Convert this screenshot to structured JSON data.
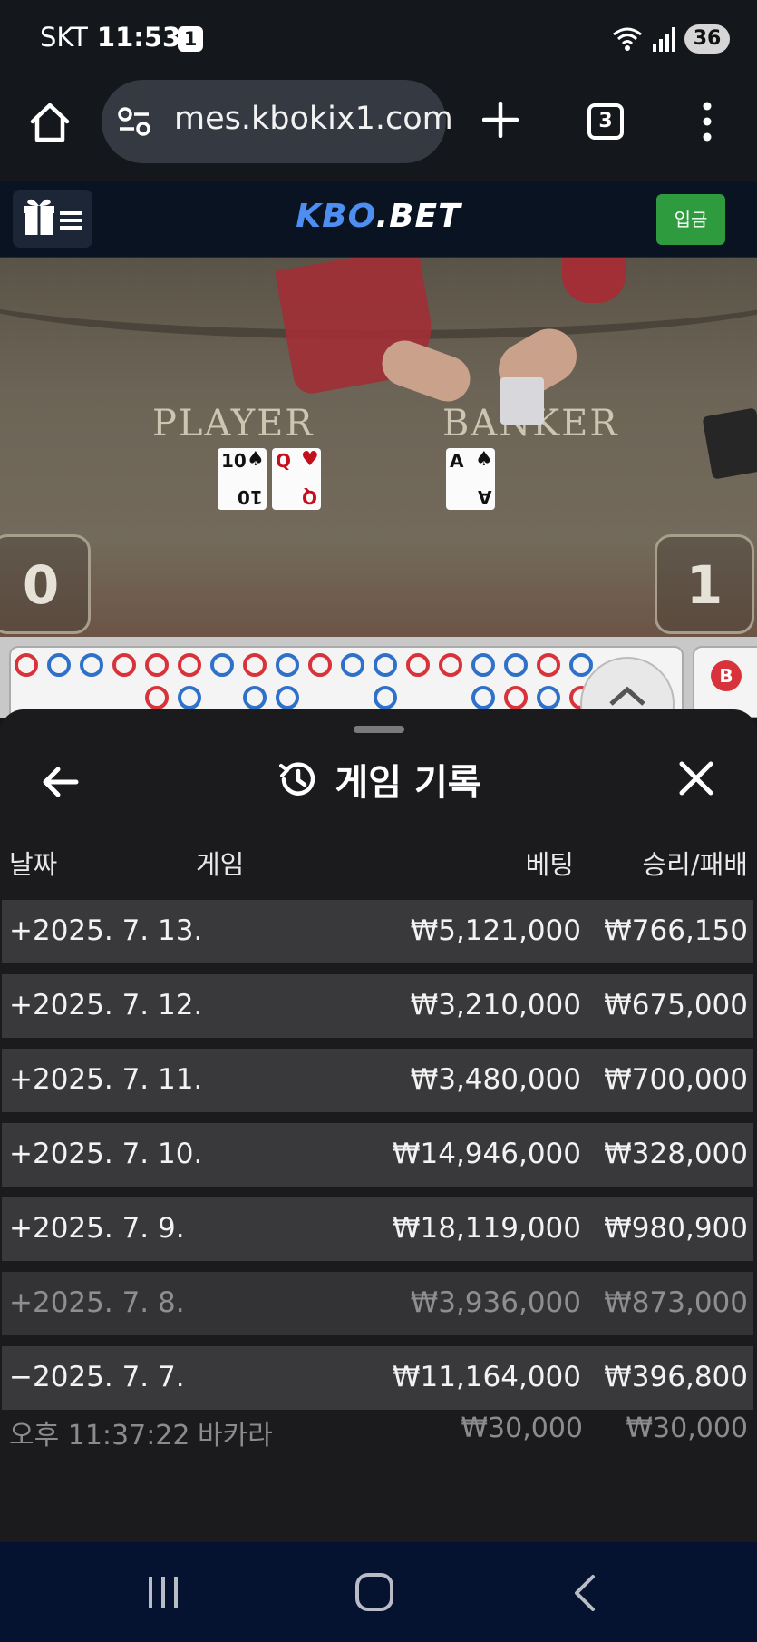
{
  "status_bar": {
    "carrier": "SKT",
    "time": "11:53",
    "notification_count": "1",
    "battery": "36"
  },
  "browser": {
    "url": "mes.kbokix1.com",
    "tab_count": "3"
  },
  "site_header": {
    "logo_prefix": "KBO",
    "logo_suffix": ".BET",
    "deposit_label": "입금"
  },
  "video": {
    "player_label": "PLAYER",
    "banker_label": "BANKER",
    "player_score": "0",
    "banker_score": "1",
    "player_cards": [
      {
        "rank": "10",
        "suit": "♠",
        "color": "#111111"
      },
      {
        "rank": "Q",
        "suit": "♥",
        "color": "#c4101d"
      }
    ],
    "banker_cards": [
      {
        "rank": "A",
        "suit": "♠",
        "color": "#111111"
      }
    ]
  },
  "roadmap": {
    "side_badge": "B"
  },
  "sheet": {
    "title": "게임 기록",
    "columns": {
      "date": "날짜",
      "game": "게임",
      "bet": "베팅",
      "result": "승리/패배"
    },
    "records": [
      {
        "date": "+2025. 7. 13.",
        "bet": "₩5,121,000",
        "result": "₩766,150"
      },
      {
        "date": "+2025. 7. 12.",
        "bet": "₩3,210,000",
        "result": "₩675,000"
      },
      {
        "date": "+2025. 7. 11.",
        "bet": "₩3,480,000",
        "result": "₩700,000"
      },
      {
        "date": "+2025. 7. 10.",
        "bet": "₩14,946,000",
        "result": "₩328,000"
      },
      {
        "date": "+2025. 7. 9.",
        "bet": "₩18,119,000",
        "result": "₩980,900"
      },
      {
        "date": "+2025. 7. 8.",
        "bet": "₩3,936,000",
        "result": "₩873,000"
      },
      {
        "date": "−2025. 7. 7.",
        "bet": "₩11,164,000",
        "result": "₩396,800"
      }
    ],
    "detail": {
      "time": "오후 11:37:22",
      "game": "바카라",
      "bet": "₩30,000",
      "result": "₩30,000"
    }
  },
  "icons": {
    "home": "home-icon",
    "site_info": "tune-icon",
    "new_tab": "plus-icon",
    "more": "more-vert-icon",
    "menu": "gift-menu-icon",
    "back": "arrow-left-icon",
    "history": "history-icon",
    "close": "close-icon"
  },
  "colors": {
    "banker_red": "#d8333a",
    "player_blue": "#2f70c9",
    "deposit_green": "#2f9b3f",
    "logo_blue": "#4d8ef0"
  }
}
